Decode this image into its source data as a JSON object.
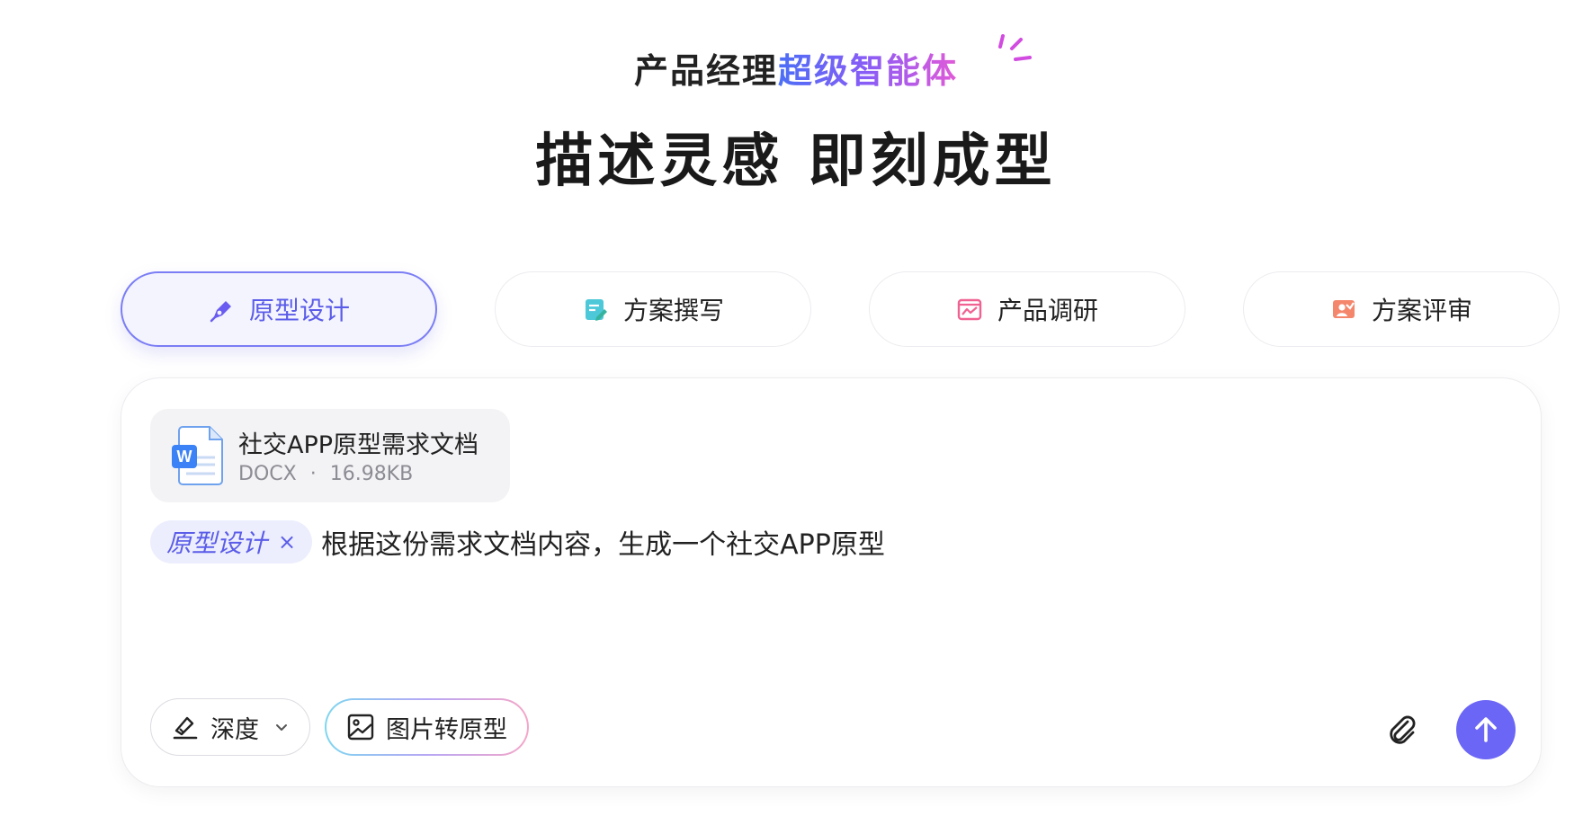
{
  "hero": {
    "subtitle_plain": "产品经理",
    "subtitle_highlight": "超级智能体",
    "headline": "描述灵感 即刻成型"
  },
  "tabs": [
    {
      "label": "原型设计",
      "icon": "pen-icon",
      "active": true
    },
    {
      "label": "方案撰写",
      "icon": "doc-edit-icon",
      "active": false
    },
    {
      "label": "产品调研",
      "icon": "chart-icon",
      "active": false
    },
    {
      "label": "方案评审",
      "icon": "review-icon",
      "active": false
    }
  ],
  "composer": {
    "file": {
      "name": "社交APP原型需求文档",
      "type": "DOCX",
      "separator": "·",
      "size": "16.98KB",
      "icon": "word-doc-icon"
    },
    "chip_label": "原型设计",
    "chip_close": "×",
    "prompt": "根据这份需求文档内容，生成一个社交APP原型",
    "mode_button": "深度",
    "image_button": "图片转原型"
  },
  "colors": {
    "accent": "#6b66f5",
    "active_tab_text": "#5b5ce8",
    "chip_bg": "#eceefd"
  }
}
